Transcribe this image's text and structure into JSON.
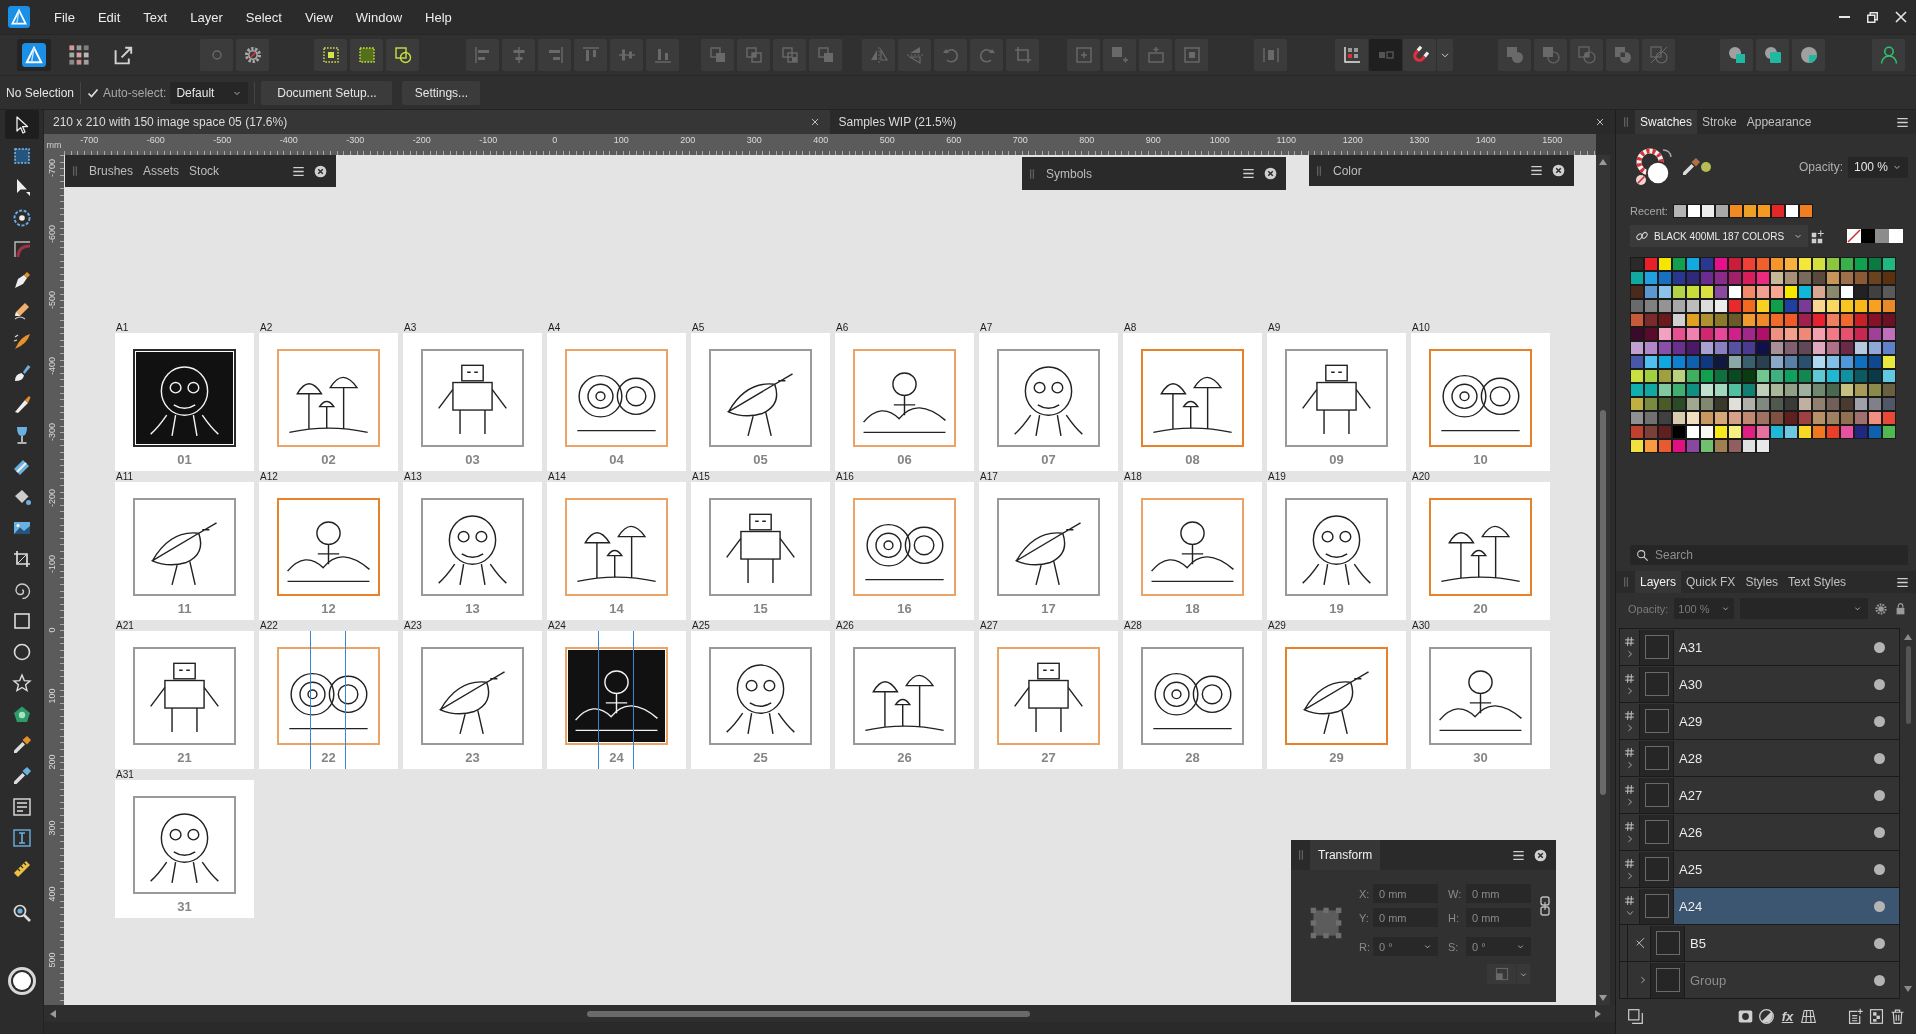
{
  "menu_bar": {
    "items": [
      "File",
      "Edit",
      "Text",
      "Layer",
      "Select",
      "View",
      "Window",
      "Help"
    ]
  },
  "toolbar": {
    "groups": [
      {
        "buttons": [
          {
            "kind": "designer",
            "selected": true,
            "disabled": false
          },
          {
            "kind": "pixel",
            "selected": false,
            "disabled": false
          },
          {
            "kind": "export",
            "selected": false,
            "disabled": false
          }
        ]
      },
      {
        "buttons": [
          {
            "kind": "circle",
            "disabled": true
          },
          {
            "kind": "gear",
            "disabled": false
          }
        ]
      },
      {
        "buttons": [
          {
            "kind": "dotted-square",
            "disabled": false
          },
          {
            "kind": "dotted-grid",
            "disabled": false
          },
          {
            "kind": "overlap",
            "disabled": false
          }
        ]
      },
      {
        "buttons": [
          {
            "kind": "align-left",
            "disabled": true
          },
          {
            "kind": "align-center",
            "disabled": true
          },
          {
            "kind": "align-right",
            "disabled": true
          },
          {
            "kind": "align-top",
            "disabled": true
          },
          {
            "kind": "align-middle",
            "disabled": true
          },
          {
            "kind": "align-bottom",
            "disabled": true
          }
        ]
      },
      {
        "buttons": [
          {
            "kind": "to-back",
            "disabled": true
          },
          {
            "kind": "back-one",
            "disabled": true
          },
          {
            "kind": "forward-one",
            "disabled": true
          },
          {
            "kind": "to-front",
            "disabled": true
          }
        ]
      },
      {
        "buttons": [
          {
            "kind": "flip-horizontal",
            "disabled": true
          },
          {
            "kind": "flip-vertical",
            "disabled": true
          },
          {
            "kind": "rotate-left",
            "disabled": true
          },
          {
            "kind": "rotate-right",
            "disabled": true
          },
          {
            "kind": "frame",
            "disabled": true
          }
        ]
      },
      {
        "buttons": [
          {
            "kind": "insert-behind",
            "disabled": true
          },
          {
            "kind": "insert-front",
            "disabled": true
          },
          {
            "kind": "insert-top",
            "disabled": true
          },
          {
            "kind": "insert-inside",
            "disabled": true
          }
        ]
      },
      {
        "buttons": [
          {
            "kind": "distribute",
            "disabled": true
          }
        ]
      },
      {
        "buttons": [
          {
            "kind": "snap-grid",
            "disabled": false
          },
          {
            "kind": "snap-box",
            "disabled": true
          },
          {
            "kind": "magnet",
            "disabled": false
          },
          {
            "kind": "caret",
            "disabled": false
          }
        ]
      },
      {
        "buttons": [
          {
            "kind": "add",
            "disabled": true
          },
          {
            "kind": "subtract",
            "disabled": true
          },
          {
            "kind": "intersect",
            "disabled": true
          },
          {
            "kind": "xor",
            "disabled": true
          },
          {
            "kind": "divide",
            "disabled": true
          }
        ]
      },
      {
        "buttons": [
          {
            "kind": "circle-square",
            "disabled": false
          },
          {
            "kind": "square-circle",
            "disabled": false
          },
          {
            "kind": "circle-quarter",
            "disabled": false
          }
        ]
      },
      {
        "buttons": [
          {
            "kind": "person",
            "disabled": false
          }
        ]
      }
    ]
  },
  "context_bar": {
    "selection": "No Selection",
    "auto_select": {
      "label": "Auto-select:",
      "checked": true
    },
    "mode": "Default",
    "buttons": [
      "Document Setup...",
      "Settings..."
    ]
  },
  "document_tabs": [
    {
      "title": "210 x 210 with 150 image space 05 (17.6%)",
      "selected": true
    },
    {
      "title": "Samples WIP (21.5%)",
      "selected": false
    }
  ],
  "tools": {
    "groups": [
      {
        "items": [
          {
            "kind": "move",
            "selected": true
          },
          {
            "kind": "artboard",
            "selected": false
          },
          {
            "kind": "node",
            "selected": false
          },
          {
            "kind": "point-transform",
            "selected": false
          },
          {
            "kind": "corner",
            "selected": false
          },
          {
            "kind": "pen",
            "selected": false
          },
          {
            "kind": "pencil",
            "selected": false
          },
          {
            "kind": "vector-brush",
            "selected": false
          },
          {
            "kind": "paint-brush",
            "selected": false
          },
          {
            "kind": "knife",
            "selected": false
          },
          {
            "kind": "glass",
            "selected": false
          },
          {
            "kind": "eraser",
            "selected": false
          },
          {
            "kind": "bucket",
            "selected": false
          },
          {
            "kind": "image",
            "selected": false
          },
          {
            "kind": "crop",
            "selected": false
          },
          {
            "kind": "spiral",
            "selected": false
          },
          {
            "kind": "rectangle",
            "selected": false
          },
          {
            "kind": "ellipse",
            "selected": false
          },
          {
            "kind": "star",
            "selected": false
          },
          {
            "kind": "shapes",
            "selected": false
          },
          {
            "kind": "eyedropper",
            "selected": false
          },
          {
            "kind": "picker",
            "selected": false
          },
          {
            "kind": "text-frame",
            "selected": false
          },
          {
            "kind": "text",
            "selected": false
          },
          {
            "kind": "ruler",
            "selected": false
          }
        ]
      },
      {
        "items": [
          {
            "kind": "zoom",
            "selected": false
          }
        ]
      }
    ]
  },
  "ruler": {
    "unit": "mm",
    "x_ticks": [
      "-700",
      "-600",
      "-500",
      "-400",
      "-300",
      "-200",
      "-100",
      "0",
      "100",
      "200",
      "300",
      "400",
      "500",
      "600",
      "700",
      "800",
      "900",
      "1000",
      "1100",
      "1200",
      "1300",
      "1400",
      "1500"
    ],
    "y_ticks": [
      "-700",
      "-600",
      "-500",
      "-400",
      "-300",
      "-200",
      "-100",
      "0",
      "100",
      "200",
      "300",
      "400",
      "500"
    ]
  },
  "canvas": {
    "artboards": [
      {
        "label": "A1",
        "number": "01",
        "color": "#2a2a2a",
        "inked": true,
        "guides": false
      },
      {
        "label": "A2",
        "number": "02",
        "color": "#eaa468",
        "inked": false,
        "guides": false
      },
      {
        "label": "A3",
        "number": "03",
        "color": "#9a9a9a",
        "inked": false,
        "guides": false
      },
      {
        "label": "A4",
        "number": "04",
        "color": "#eaa468",
        "inked": false,
        "guides": false
      },
      {
        "label": "A5",
        "number": "05",
        "color": "#9a9a9a",
        "inked": false,
        "guides": false
      },
      {
        "label": "A6",
        "number": "06",
        "color": "#eaa468",
        "inked": false,
        "guides": false
      },
      {
        "label": "A7",
        "number": "07",
        "color": "#9a9a9a",
        "inked": false,
        "guides": false
      },
      {
        "label": "A8",
        "number": "08",
        "color": "#e8822a",
        "inked": false,
        "guides": false
      },
      {
        "label": "A9",
        "number": "09",
        "color": "#9a9a9a",
        "inked": false,
        "guides": false
      },
      {
        "label": "A10",
        "number": "10",
        "color": "#e8822a",
        "inked": false,
        "guides": false
      },
      {
        "label": "A11",
        "number": "11",
        "color": "#9a9a9a",
        "inked": false,
        "guides": false
      },
      {
        "label": "A12",
        "number": "12",
        "color": "#e8822a",
        "inked": false,
        "guides": false
      },
      {
        "label": "A13",
        "number": "13",
        "color": "#9a9a9a",
        "inked": false,
        "guides": false
      },
      {
        "label": "A14",
        "number": "14",
        "color": "#eaa468",
        "inked": false,
        "guides": false
      },
      {
        "label": "A15",
        "number": "15",
        "color": "#9a9a9a",
        "inked": false,
        "guides": false
      },
      {
        "label": "A16",
        "number": "16",
        "color": "#eaa468",
        "inked": false,
        "guides": false
      },
      {
        "label": "A17",
        "number": "17",
        "color": "#9a9a9a",
        "inked": false,
        "guides": false
      },
      {
        "label": "A18",
        "number": "18",
        "color": "#eaa468",
        "inked": false,
        "guides": false
      },
      {
        "label": "A19",
        "number": "19",
        "color": "#9a9a9a",
        "inked": false,
        "guides": false
      },
      {
        "label": "A20",
        "number": "20",
        "color": "#e8822a",
        "inked": false,
        "guides": false
      },
      {
        "label": "A21",
        "number": "21",
        "color": "#9a9a9a",
        "inked": false,
        "guides": false
      },
      {
        "label": "A22",
        "number": "22",
        "color": "#eaa468",
        "inked": false,
        "guides": true
      },
      {
        "label": "A23",
        "number": "23",
        "color": "#9a9a9a",
        "inked": false,
        "guides": false
      },
      {
        "label": "A24",
        "number": "24",
        "color": "#eaa468",
        "inked": true,
        "guides": true
      },
      {
        "label": "A25",
        "number": "25",
        "color": "#9a9a9a",
        "inked": false,
        "guides": false
      },
      {
        "label": "A26",
        "number": "26",
        "color": "#9a9a9a",
        "inked": false,
        "guides": false
      },
      {
        "label": "A27",
        "number": "27",
        "color": "#eaa468",
        "inked": false,
        "guides": false
      },
      {
        "label": "A28",
        "number": "28",
        "color": "#9a9a9a",
        "inked": false,
        "guides": false
      },
      {
        "label": "A29",
        "number": "29",
        "color": "#e8822a",
        "inked": false,
        "guides": false
      },
      {
        "label": "A30",
        "number": "30",
        "color": "#9a9a9a",
        "inked": false,
        "guides": false
      },
      {
        "label": "A31",
        "number": "31",
        "color": "#9a9a9a",
        "inked": false,
        "guides": false
      }
    ]
  },
  "floating_panels": [
    {
      "tabs": [
        {
          "label": "Brushes",
          "selected": false
        },
        {
          "label": "Assets",
          "selected": false
        },
        {
          "label": "Stock",
          "selected": false
        }
      ]
    },
    {
      "tabs": [
        {
          "label": "Symbols",
          "selected": false
        }
      ]
    },
    {
      "tabs": [
        {
          "label": "Color",
          "selected": false
        }
      ]
    }
  ],
  "transform_panel": {
    "tab": {
      "label": "Transform",
      "selected": true
    },
    "disabled": true,
    "fields": [
      {
        "label": "X:",
        "value": "0 mm",
        "kind": "text"
      },
      {
        "label": "W:",
        "value": "0 mm",
        "kind": "text"
      },
      {
        "label": "Y:",
        "value": "0 mm",
        "kind": "text"
      },
      {
        "label": "H:",
        "value": "0 mm",
        "kind": "text"
      },
      {
        "label": "R:",
        "value": "0 °",
        "kind": "dropdown"
      },
      {
        "label": "S:",
        "value": "0 °",
        "kind": "dropdown"
      }
    ]
  },
  "swatches_panel": {
    "tabs": [
      {
        "label": "Swatches",
        "selected": true
      },
      {
        "label": "Stroke",
        "selected": false
      },
      {
        "label": "Appearance",
        "selected": false
      }
    ],
    "opacity": {
      "label": "Opacity:",
      "value": "100 %"
    },
    "recent": {
      "label": "Recent:",
      "colors": [
        {
          "color": "#b4b4b4"
        },
        {
          "color": "#ffffff"
        },
        {
          "color": "#ececec"
        },
        {
          "color": "#a8a8a8"
        },
        {
          "color": "#f28a22"
        },
        {
          "color": "#eea024"
        },
        {
          "color": "#f49a22"
        },
        {
          "color": "#e42828"
        },
        {
          "color": "#ffffff"
        },
        {
          "color": "#f27e22"
        }
      ]
    },
    "palette": "BLACK 400ML 187 COLORS",
    "basic": [
      {
        "kind": "none"
      },
      {
        "kind": "solid",
        "color": "#000000"
      },
      {
        "kind": "solid",
        "color": "#8c8c8c"
      },
      {
        "kind": "solid",
        "color": "#ffffff"
      }
    ],
    "swatches": [
      {
        "color": "#2a2a2a"
      },
      {
        "color": "#e8202a"
      },
      {
        "color": "#f5e600"
      },
      {
        "color": "#12a050"
      },
      {
        "color": "#12a8e0"
      },
      {
        "color": "#2a3890"
      },
      {
        "color": "#e8108a"
      },
      {
        "color": "#c81e3c"
      },
      {
        "color": "#ee4036"
      },
      {
        "color": "#f0602a"
      },
      {
        "color": "#f5962a"
      },
      {
        "color": "#f8b040"
      },
      {
        "color": "#f5e63c"
      },
      {
        "color": "#d4e040"
      },
      {
        "color": "#8cc63e"
      },
      {
        "color": "#3ab04a"
      },
      {
        "color": "#10a050"
      },
      {
        "color": "#0a7a40"
      },
      {
        "color": "#20b880"
      },
      {
        "color": "#10a8a0"
      },
      {
        "color": "#20a0e0"
      },
      {
        "color": "#1a70c0"
      },
      {
        "color": "#283890"
      },
      {
        "color": "#2e2a78"
      },
      {
        "color": "#6a2c90"
      },
      {
        "color": "#8c2a8a"
      },
      {
        "color": "#a0206a"
      },
      {
        "color": "#d81e5a"
      },
      {
        "color": "#ec2a80"
      },
      {
        "color": "#c8b89a"
      },
      {
        "color": "#a89078"
      },
      {
        "color": "#7a6a5a"
      },
      {
        "color": "#5a4a3c"
      },
      {
        "color": "#c8965a"
      },
      {
        "color": "#a0704a"
      },
      {
        "color": "#8a5a34"
      },
      {
        "color": "#6a4220"
      },
      {
        "color": "#5a3212"
      },
      {
        "color": "#4a2a1a"
      },
      {
        "color": "#5c98d0"
      },
      {
        "color": "#8cc4e8"
      },
      {
        "color": "#b4d24a"
      },
      {
        "color": "#c8dc3a"
      },
      {
        "color": "#dce040"
      },
      {
        "color": "#8a4aa0"
      },
      {
        "color": "#ffffff"
      },
      {
        "color": "#f08a6a"
      },
      {
        "color": "#f4a090"
      },
      {
        "color": "#f8a890"
      },
      {
        "color": "#f8e800"
      },
      {
        "color": "#10b8d8"
      },
      {
        "color": "#d8a890"
      },
      {
        "color": "#8a8a6a"
      },
      {
        "color": "#ffffff"
      },
      {
        "color": "#222222"
      },
      {
        "color": "#404040"
      },
      {
        "color": "#5a5a5a"
      },
      {
        "color": "#6a6a6a"
      },
      {
        "color": "#808080"
      },
      {
        "color": "#949494"
      },
      {
        "color": "#a8a8a8"
      },
      {
        "color": "#bcbcbc"
      },
      {
        "color": "#dcdcdc"
      },
      {
        "color": "#ececec"
      },
      {
        "color": "#e82a2a"
      },
      {
        "color": "#f06a20"
      },
      {
        "color": "#f8d020"
      },
      {
        "color": "#10a048"
      },
      {
        "color": "#2040a0"
      },
      {
        "color": "#7a3a98"
      },
      {
        "color": "#f8d890"
      },
      {
        "color": "#f8d860"
      },
      {
        "color": "#f8c820"
      },
      {
        "color": "#f8b818"
      },
      {
        "color": "#f8a020"
      },
      {
        "color": "#e88a28"
      },
      {
        "color": "#c85a3a"
      },
      {
        "color": "#7a2a2a"
      },
      {
        "color": "#6a1a1a"
      },
      {
        "color": "#d0d0d0"
      },
      {
        "color": "#e0a020"
      },
      {
        "color": "#b09030"
      },
      {
        "color": "#8a7a2a"
      },
      {
        "color": "#6a5a2a"
      },
      {
        "color": "#f09a30"
      },
      {
        "color": "#f08a28"
      },
      {
        "color": "#f06a28"
      },
      {
        "color": "#f05a28"
      },
      {
        "color": "#a02050"
      },
      {
        "color": "#e82030"
      },
      {
        "color": "#f08060"
      },
      {
        "color": "#f06a30"
      },
      {
        "color": "#c82028"
      },
      {
        "color": "#8a1028"
      },
      {
        "color": "#6a1020"
      },
      {
        "color": "#3a0a2a"
      },
      {
        "color": "#5a0a2a"
      },
      {
        "color": "#f4a0c0"
      },
      {
        "color": "#e85090"
      },
      {
        "color": "#f080b0"
      },
      {
        "color": "#d02870"
      },
      {
        "color": "#e84898"
      },
      {
        "color": "#d0208a"
      },
      {
        "color": "#a02888"
      },
      {
        "color": "#b0106a"
      },
      {
        "color": "#f09080"
      },
      {
        "color": "#f4a090"
      },
      {
        "color": "#f08878"
      },
      {
        "color": "#f4a0b0"
      },
      {
        "color": "#f07a88"
      },
      {
        "color": "#e85070"
      },
      {
        "color": "#c82850"
      },
      {
        "color": "#a04098"
      },
      {
        "color": "#c070b8"
      },
      {
        "color": "#c0a0d0"
      },
      {
        "color": "#b088c8"
      },
      {
        "color": "#8850a8"
      },
      {
        "color": "#6a3090"
      },
      {
        "color": "#4a1a68"
      },
      {
        "color": "#a8a0d0"
      },
      {
        "color": "#8880c0"
      },
      {
        "color": "#5850a0"
      },
      {
        "color": "#4a3a90"
      },
      {
        "color": "#10104a"
      },
      {
        "color": "#a89098"
      },
      {
        "color": "#806070"
      },
      {
        "color": "#604858"
      },
      {
        "color": "#e0a8c0"
      },
      {
        "color": "#b07088"
      },
      {
        "color": "#6a2a48"
      },
      {
        "color": "#b8c8e0"
      },
      {
        "color": "#90a8d8"
      },
      {
        "color": "#6080c8"
      },
      {
        "color": "#4858a8"
      },
      {
        "color": "#50c0f0"
      },
      {
        "color": "#10a8e0"
      },
      {
        "color": "#1080d0"
      },
      {
        "color": "#1060b0"
      },
      {
        "color": "#103880"
      },
      {
        "color": "#101840"
      },
      {
        "color": "#8aa8a8"
      },
      {
        "color": "#3a6070"
      },
      {
        "color": "#2a4050"
      },
      {
        "color": "#8aa8c8"
      },
      {
        "color": "#5a80a8"
      },
      {
        "color": "#2a5070"
      },
      {
        "color": "#b0d8f0"
      },
      {
        "color": "#80c0e8"
      },
      {
        "color": "#5098d8"
      },
      {
        "color": "#1070c0"
      },
      {
        "color": "#104890"
      },
      {
        "color": "#e8e840"
      },
      {
        "color": "#c8e040"
      },
      {
        "color": "#a0d040"
      },
      {
        "color": "#a0a040"
      },
      {
        "color": "#b8d080"
      },
      {
        "color": "#40b060"
      },
      {
        "color": "#10a050"
      },
      {
        "color": "#107040"
      },
      {
        "color": "#0a4a20"
      },
      {
        "color": "#0a3a10"
      },
      {
        "color": "#70c890"
      },
      {
        "color": "#40b080"
      },
      {
        "color": "#10a060"
      },
      {
        "color": "#108850"
      },
      {
        "color": "#60c8d0"
      },
      {
        "color": "#20b8d0"
      },
      {
        "color": "#1090a0"
      },
      {
        "color": "#0a5a60"
      },
      {
        "color": "#0a3a48"
      },
      {
        "color": "#60c8e0"
      },
      {
        "color": "#10b0b0"
      },
      {
        "color": "#10a8a0"
      },
      {
        "color": "#80c8a0"
      },
      {
        "color": "#40b070"
      },
      {
        "color": "#109080"
      },
      {
        "color": "#c0e0d0"
      },
      {
        "color": "#a0d8c0"
      },
      {
        "color": "#50c0a0"
      },
      {
        "color": "#108070"
      },
      {
        "color": "#c0d0b8"
      },
      {
        "color": "#a8b898"
      },
      {
        "color": "#90a088"
      },
      {
        "color": "#a0b0a0"
      },
      {
        "color": "#708870"
      },
      {
        "color": "#4a6850"
      },
      {
        "color": "#c8c080"
      },
      {
        "color": "#a89a58"
      },
      {
        "color": "#8a8a4a"
      },
      {
        "color": "#6a6040"
      },
      {
        "color": "#c0b040"
      },
      {
        "color": "#7a8a40"
      },
      {
        "color": "#4a5a28"
      },
      {
        "color": "#2a4a28"
      },
      {
        "color": "#a0a890"
      },
      {
        "color": "#808870"
      },
      {
        "color": "#3a3a2a"
      },
      {
        "color": "#e0e0d8"
      },
      {
        "color": "#b0b0a8"
      },
      {
        "color": "#808880"
      },
      {
        "color": "#505850"
      },
      {
        "color": "#3a3a38"
      },
      {
        "color": "#c0b0a0"
      },
      {
        "color": "#908070"
      },
      {
        "color": "#706058"
      },
      {
        "color": "#4a3a30"
      },
      {
        "color": "#a0a0a8"
      },
      {
        "color": "#808088"
      },
      {
        "color": "#505868"
      },
      {
        "color": "#909090"
      },
      {
        "color": "#707070"
      },
      {
        "color": "#404040"
      },
      {
        "color": "#d8ccb0"
      },
      {
        "color": "#f0e0c0"
      },
      {
        "color": "#c89860"
      },
      {
        "color": "#d8a878"
      },
      {
        "color": "#d8a088"
      },
      {
        "color": "#c08870"
      },
      {
        "color": "#a07060"
      },
      {
        "color": "#805040"
      },
      {
        "color": "#602020"
      },
      {
        "color": "#a04040"
      },
      {
        "color": "#b89068"
      },
      {
        "color": "#a08060"
      },
      {
        "color": "#907050"
      },
      {
        "color": "#a07070"
      },
      {
        "color": "#f09080"
      },
      {
        "color": "#e84838"
      },
      {
        "color": "#c04030"
      },
      {
        "color": "#7a4038"
      },
      {
        "color": "#602020"
      },
      {
        "color": "#000000"
      },
      {
        "color": "#ffffff"
      },
      {
        "color": "#f8f8f0"
      },
      {
        "color": "#f8e820"
      },
      {
        "color": "#f8f080"
      },
      {
        "color": "#e02080"
      },
      {
        "color": "#e870a0"
      },
      {
        "color": "#20b8d8"
      },
      {
        "color": "#70c8e0"
      },
      {
        "color": "#f8d820"
      },
      {
        "color": "#f07820"
      },
      {
        "color": "#e84028"
      },
      {
        "color": "#e850a0"
      },
      {
        "color": "#202880"
      },
      {
        "color": "#1060b0"
      },
      {
        "color": "#50b850"
      },
      {
        "color": "#f0e040"
      },
      {
        "color": "#f89a40"
      },
      {
        "color": "#e85a30"
      },
      {
        "color": "#e01080"
      },
      {
        "color": "#8848a0"
      },
      {
        "color": "#70c070"
      },
      {
        "color": "#a08050"
      },
      {
        "color": "#906060"
      },
      {
        "color": "#e0e0e0"
      },
      {
        "color": "#e8e8e8"
      }
    ]
  },
  "search": {
    "placeholder": "Search"
  },
  "layers_panel": {
    "tabs": [
      {
        "label": "Layers",
        "selected": true
      },
      {
        "label": "Quick FX",
        "selected": false
      },
      {
        "label": "Styles",
        "selected": false
      },
      {
        "label": "Text Styles",
        "selected": false
      }
    ],
    "opacity": {
      "label": "Opacity:",
      "value": "100 %",
      "disabled": true
    },
    "fx_label": "fx",
    "layers": [
      {
        "name": "A31",
        "kind": "artboard",
        "expanded": false,
        "selected": false,
        "visible": true
      },
      {
        "name": "A30",
        "kind": "artboard",
        "expanded": false,
        "selected": false,
        "visible": true
      },
      {
        "name": "A29",
        "kind": "artboard",
        "expanded": false,
        "selected": false,
        "visible": true
      },
      {
        "name": "A28",
        "kind": "artboard",
        "expanded": false,
        "selected": false,
        "visible": true
      },
      {
        "name": "A27",
        "kind": "artboard",
        "expanded": false,
        "selected": false,
        "visible": true
      },
      {
        "name": "A26",
        "kind": "artboard",
        "expanded": false,
        "selected": false,
        "visible": true
      },
      {
        "name": "A25",
        "kind": "artboard",
        "expanded": false,
        "selected": false,
        "visible": true
      },
      {
        "name": "A24",
        "kind": "artboard",
        "expanded": true,
        "selected": true,
        "visible": true,
        "children": [
          {
            "name": "B5",
            "kind": "clip",
            "selected": false,
            "visible": true
          },
          {
            "name": "Group",
            "kind": "group",
            "expanded": false,
            "selected": false,
            "visible": true
          }
        ]
      }
    ]
  }
}
